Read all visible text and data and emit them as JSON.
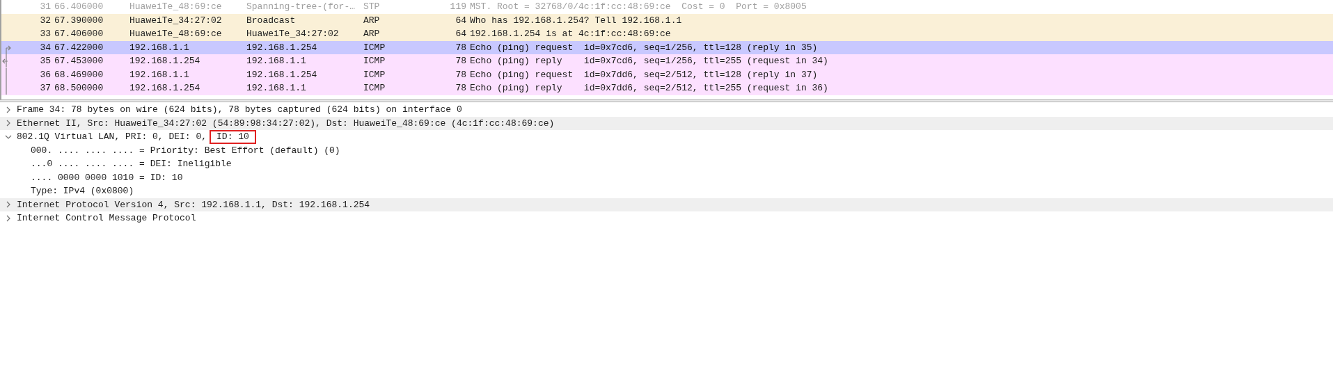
{
  "packet_list": {
    "rows": [
      {
        "no": "31",
        "time": "66.406000",
        "source": "HuaweiTe_48:69:ce",
        "destination": "Spanning-tree-(for-…",
        "protocol": "STP",
        "length": "119",
        "info": "MST. Root = 32768/0/4c:1f:cc:48:69:ce  Cost = 0  Port = 0x8005",
        "kind": "stp",
        "selected": false
      },
      {
        "no": "32",
        "time": "67.390000",
        "source": "HuaweiTe_34:27:02",
        "destination": "Broadcast",
        "protocol": "ARP",
        "length": "64",
        "info": "Who has 192.168.1.254? Tell 192.168.1.1",
        "kind": "arp",
        "selected": false
      },
      {
        "no": "33",
        "time": "67.406000",
        "source": "HuaweiTe_48:69:ce",
        "destination": "HuaweiTe_34:27:02",
        "protocol": "ARP",
        "length": "64",
        "info": "192.168.1.254 is at 4c:1f:cc:48:69:ce",
        "kind": "arp",
        "selected": false
      },
      {
        "no": "34",
        "time": "67.422000",
        "source": "192.168.1.1",
        "destination": "192.168.1.254",
        "protocol": "ICMP",
        "length": "78",
        "info": "Echo (ping) request  id=0x7cd6, seq=1/256, ttl=128 (reply in 35)",
        "kind": "icmp",
        "selected": true,
        "related": {
          "kind": "request"
        }
      },
      {
        "no": "35",
        "time": "67.453000",
        "source": "192.168.1.254",
        "destination": "192.168.1.1",
        "protocol": "ICMP",
        "length": "78",
        "info": "Echo (ping) reply    id=0x7cd6, seq=1/256, ttl=255 (request in 34)",
        "kind": "icmp",
        "selected": false,
        "related": {
          "kind": "reply"
        }
      },
      {
        "no": "36",
        "time": "68.469000",
        "source": "192.168.1.1",
        "destination": "192.168.1.254",
        "protocol": "ICMP",
        "length": "78",
        "info": "Echo (ping) request  id=0x7dd6, seq=2/512, ttl=128 (reply in 37)",
        "kind": "icmp",
        "selected": false,
        "related": {
          "kind": "line"
        }
      },
      {
        "no": "37",
        "time": "68.500000",
        "source": "192.168.1.254",
        "destination": "192.168.1.1",
        "protocol": "ICMP",
        "length": "78",
        "info": "Echo (ping) reply    id=0x7dd6, seq=2/512, ttl=255 (request in 36)",
        "kind": "icmp",
        "selected": false,
        "related": {
          "kind": "line"
        }
      }
    ]
  },
  "details": [
    {
      "label": "Frame 34: 78 bytes on wire (624 bits), 78 bytes captured (624 bits) on interface 0",
      "expanded": false
    },
    {
      "label": "Ethernet II, Src: HuaweiTe_34:27:02 (54:89:98:34:27:02), Dst: HuaweiTe_48:69:ce (4c:1f:cc:48:69:ce)",
      "expanded": false
    },
    {
      "label": "802.1Q Virtual LAN, PRI: 0, DEI: 0,",
      "boxed": "ID: 10",
      "expanded": true,
      "children": [
        {
          "label": "000. .... .... .... = Priority: Best Effort (default) (0)"
        },
        {
          "label": "...0 .... .... .... = DEI: Ineligible"
        },
        {
          "label": ".... 0000 0000 1010 = ID: 10"
        },
        {
          "label": "Type: IPv4 (0x0800)"
        }
      ]
    },
    {
      "label": "Internet Protocol Version 4, Src: 192.168.1.1, Dst: 192.168.1.254",
      "expanded": false
    },
    {
      "label": "Internet Control Message Protocol",
      "expanded": false
    }
  ]
}
